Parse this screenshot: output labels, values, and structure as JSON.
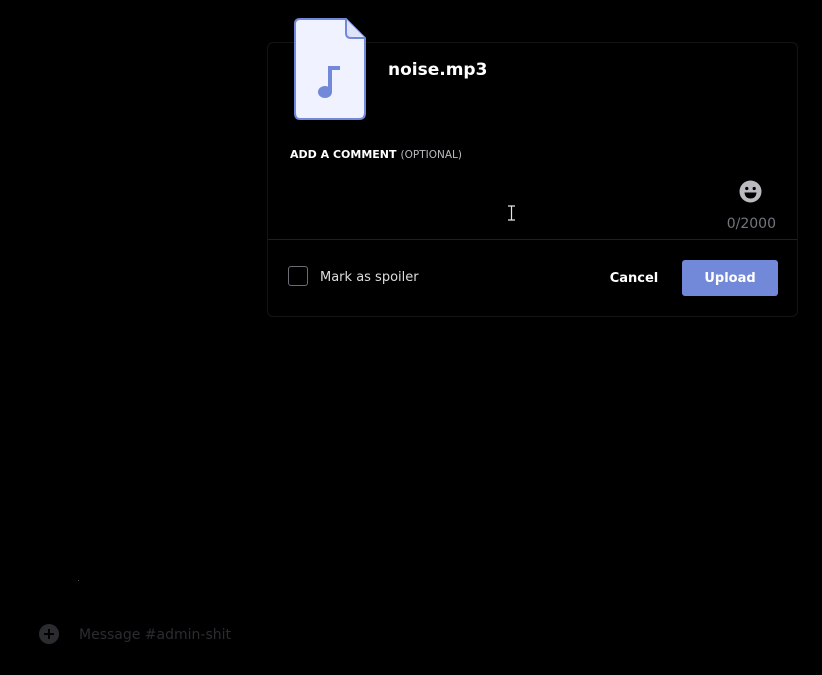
{
  "upload_modal": {
    "file_name": "noise.mp3",
    "file_icon": "music-note-file-icon",
    "comment_label": "ADD A COMMENT",
    "comment_optional": "(OPTIONAL)",
    "comment_value": "",
    "char_counter": "0/2000",
    "spoiler_label": "Mark as spoiler",
    "spoiler_checked": false,
    "cancel_label": "Cancel",
    "upload_label": "Upload"
  },
  "chat": {
    "message_placeholder": "Message #admin-shit"
  },
  "colors": {
    "background": "#000000",
    "accent": "#7289da",
    "file_icon_fill": "#f0f2ff",
    "muted_text": "#72767d"
  }
}
